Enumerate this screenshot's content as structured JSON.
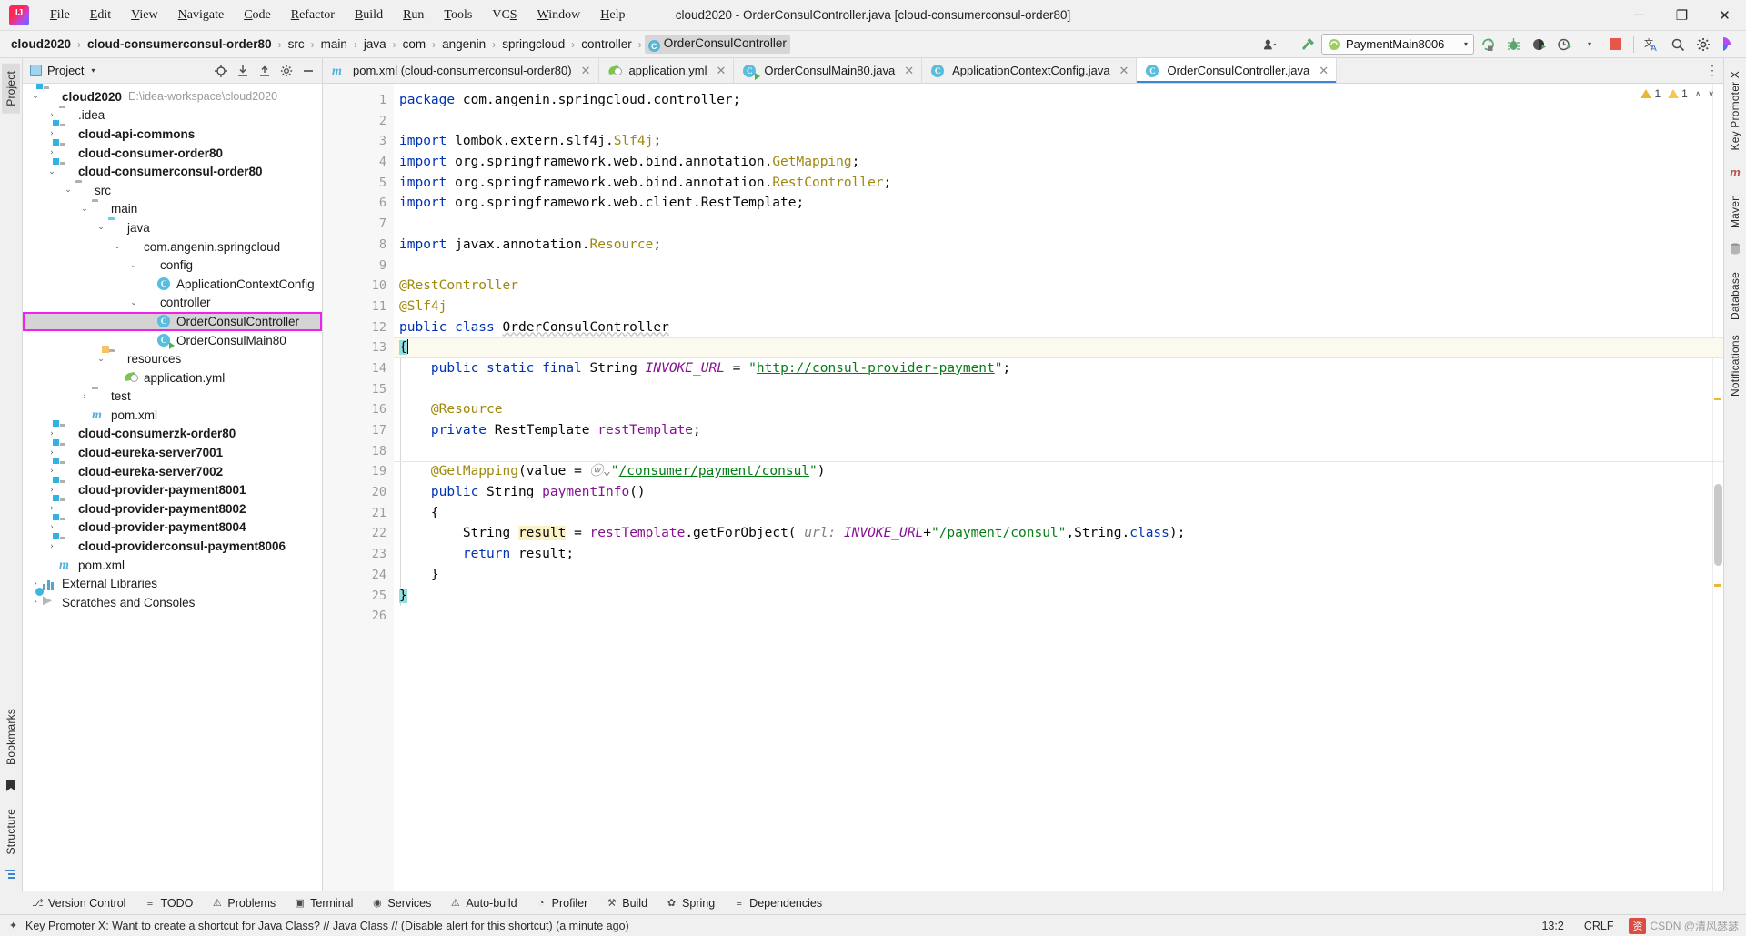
{
  "window": {
    "title": "cloud2020 - OrderConsulController.java [cloud-consumerconsul-order80]",
    "logo_text": "IJ",
    "minimize": "─",
    "maximize": "❐",
    "close": "✕"
  },
  "menubar": {
    "items": [
      {
        "pre": "",
        "mn": "F",
        "post": "ile"
      },
      {
        "pre": "",
        "mn": "E",
        "post": "dit"
      },
      {
        "pre": "",
        "mn": "V",
        "post": "iew"
      },
      {
        "pre": "",
        "mn": "N",
        "post": "avigate"
      },
      {
        "pre": "",
        "mn": "C",
        "post": "ode"
      },
      {
        "pre": "",
        "mn": "R",
        "post": "efactor"
      },
      {
        "pre": "",
        "mn": "B",
        "post": "uild"
      },
      {
        "pre": "",
        "mn": "R",
        "post": "un"
      },
      {
        "pre": "",
        "mn": "T",
        "post": "ools"
      },
      {
        "pre": "VC",
        "mn": "S",
        "post": ""
      },
      {
        "pre": "",
        "mn": "W",
        "post": "indow"
      },
      {
        "pre": "",
        "mn": "H",
        "post": "elp"
      }
    ]
  },
  "breadcrumb": {
    "separator": "›",
    "items": [
      {
        "label": "cloud2020",
        "bold": true,
        "icon": null
      },
      {
        "label": "cloud-consumerconsul-order80",
        "bold": true,
        "icon": null
      },
      {
        "label": "src",
        "bold": false,
        "icon": null
      },
      {
        "label": "main",
        "bold": false,
        "icon": null
      },
      {
        "label": "java",
        "bold": false,
        "icon": null
      },
      {
        "label": "com",
        "bold": false,
        "icon": null
      },
      {
        "label": "angenin",
        "bold": false,
        "icon": null
      },
      {
        "label": "springcloud",
        "bold": false,
        "icon": null
      },
      {
        "label": "controller",
        "bold": false,
        "icon": null
      },
      {
        "label": "OrderConsulController",
        "bold": false,
        "icon": "C"
      }
    ]
  },
  "toolbar": {
    "user_icon": "user-dropdown",
    "build_hammer": "build-icon",
    "run_config_name": "PaymentMain8006",
    "run_config_caret": "▾",
    "rerun": "↻",
    "debug": "debug-icon",
    "coverage": "coverage-icon",
    "profiler": "profiler-icon",
    "profiler_caret": "▾",
    "stop": "stop-icon",
    "translate": "translate-icon",
    "search": "⌕",
    "settings": "⚙",
    "play_brand": "brand-icon"
  },
  "left_strip": {
    "project_tab": "Project",
    "bookmarks_tab": "Bookmarks",
    "structure_tab": "Structure"
  },
  "right_strip": {
    "items": [
      "Key Promoter X",
      "Maven",
      "Database",
      "Notifications"
    ]
  },
  "project_panel": {
    "title": "Project",
    "caret": "▾",
    "icons": [
      "locate-icon",
      "expand-all-icon",
      "collapse-all-icon",
      "settings-icon",
      "hide-icon"
    ],
    "tree": [
      {
        "indent": 0,
        "twist": "⌄",
        "icon": "module",
        "label": "cloud2020",
        "bold": true,
        "path": "E:\\idea-workspace\\cloud2020"
      },
      {
        "indent": 1,
        "twist": "›",
        "icon": "folder",
        "label": ".idea",
        "bold": false,
        "path": ""
      },
      {
        "indent": 1,
        "twist": "›",
        "icon": "module",
        "label": "cloud-api-commons",
        "bold": true,
        "path": ""
      },
      {
        "indent": 1,
        "twist": "›",
        "icon": "module",
        "label": "cloud-consumer-order80",
        "bold": true,
        "path": ""
      },
      {
        "indent": 1,
        "twist": "⌄",
        "icon": "module",
        "label": "cloud-consumerconsul-order80",
        "bold": true,
        "path": ""
      },
      {
        "indent": 2,
        "twist": "⌄",
        "icon": "folder",
        "label": "src",
        "bold": false,
        "path": ""
      },
      {
        "indent": 3,
        "twist": "⌄",
        "icon": "folder",
        "label": "main",
        "bold": false,
        "path": ""
      },
      {
        "indent": 4,
        "twist": "⌄",
        "icon": "folder-blue",
        "label": "java",
        "bold": false,
        "path": ""
      },
      {
        "indent": 5,
        "twist": "⌄",
        "icon": "package",
        "label": "com.angenin.springcloud",
        "bold": false,
        "path": ""
      },
      {
        "indent": 6,
        "twist": "⌄",
        "icon": "package",
        "label": "config",
        "bold": false,
        "path": ""
      },
      {
        "indent": 7,
        "twist": "",
        "icon": "class",
        "label": "ApplicationContextConfig",
        "bold": false,
        "path": ""
      },
      {
        "indent": 6,
        "twist": "⌄",
        "icon": "package",
        "label": "controller",
        "bold": false,
        "path": ""
      },
      {
        "indent": 7,
        "twist": "",
        "icon": "class",
        "label": "OrderConsulController",
        "bold": false,
        "path": "",
        "selected": true,
        "boxed": true
      },
      {
        "indent": 7,
        "twist": "",
        "icon": "class-run",
        "label": "OrderConsulMain80",
        "bold": false,
        "path": ""
      },
      {
        "indent": 4,
        "twist": "⌄",
        "icon": "folder-res",
        "label": "resources",
        "bold": false,
        "path": ""
      },
      {
        "indent": 5,
        "twist": "",
        "icon": "yml",
        "label": "application.yml",
        "bold": false,
        "path": ""
      },
      {
        "indent": 3,
        "twist": "›",
        "icon": "folder",
        "label": "test",
        "bold": false,
        "path": ""
      },
      {
        "indent": 3,
        "twist": "",
        "icon": "maven",
        "label": "pom.xml",
        "bold": false,
        "path": ""
      },
      {
        "indent": 1,
        "twist": "›",
        "icon": "module",
        "label": "cloud-consumerzk-order80",
        "bold": true,
        "path": ""
      },
      {
        "indent": 1,
        "twist": "›",
        "icon": "module",
        "label": "cloud-eureka-server7001",
        "bold": true,
        "path": ""
      },
      {
        "indent": 1,
        "twist": "›",
        "icon": "module",
        "label": "cloud-eureka-server7002",
        "bold": true,
        "path": ""
      },
      {
        "indent": 1,
        "twist": "›",
        "icon": "module",
        "label": "cloud-provider-payment8001",
        "bold": true,
        "path": ""
      },
      {
        "indent": 1,
        "twist": "›",
        "icon": "module",
        "label": "cloud-provider-payment8002",
        "bold": true,
        "path": ""
      },
      {
        "indent": 1,
        "twist": "›",
        "icon": "module",
        "label": "cloud-provider-payment8004",
        "bold": true,
        "path": ""
      },
      {
        "indent": 1,
        "twist": "›",
        "icon": "module",
        "label": "cloud-providerconsul-payment8006",
        "bold": true,
        "path": ""
      },
      {
        "indent": 1,
        "twist": "",
        "icon": "maven",
        "label": "pom.xml",
        "bold": false,
        "path": ""
      },
      {
        "indent": 0,
        "twist": "›",
        "icon": "lib",
        "label": "External Libraries",
        "bold": false,
        "path": ""
      },
      {
        "indent": 0,
        "twist": "›",
        "icon": "scratch",
        "label": "Scratches and Consoles",
        "bold": false,
        "path": ""
      }
    ]
  },
  "editor_tabs": {
    "tabs": [
      {
        "label": "pom.xml (cloud-consumerconsul-order80)",
        "icon": "maven",
        "active": false,
        "close": "✕"
      },
      {
        "label": "application.yml",
        "icon": "yml",
        "active": false,
        "close": "✕"
      },
      {
        "label": "OrderConsulMain80.java",
        "icon": "class-run",
        "active": false,
        "close": "✕"
      },
      {
        "label": "ApplicationContextConfig.java",
        "icon": "class",
        "active": false,
        "close": "✕"
      },
      {
        "label": "OrderConsulController.java",
        "icon": "class",
        "active": true,
        "close": "✕"
      }
    ],
    "overflow": "⋮"
  },
  "inspections": {
    "warn_count_1": "1",
    "warn_count_2": "1",
    "caret_up": "∧",
    "caret_down": "∨"
  },
  "code": {
    "lines": [
      {
        "n": 1,
        "fold": "",
        "run": false,
        "caret": false,
        "tokens": [
          {
            "t": "package ",
            "c": "k"
          },
          {
            "t": "com.angenin.springcloud.controller;",
            "c": ""
          }
        ]
      },
      {
        "n": 2,
        "fold": "",
        "run": false,
        "caret": false,
        "tokens": []
      },
      {
        "n": 3,
        "fold": "⊖",
        "run": false,
        "caret": false,
        "tokens": [
          {
            "t": "import ",
            "c": "k"
          },
          {
            "t": "lombok.extern.slf4j.",
            "c": ""
          },
          {
            "t": "Slf4j",
            "c": "an"
          },
          {
            "t": ";",
            "c": ""
          }
        ]
      },
      {
        "n": 4,
        "fold": "",
        "run": false,
        "caret": false,
        "tokens": [
          {
            "t": "import ",
            "c": "k"
          },
          {
            "t": "org.springframework.web.bind.annotation.",
            "c": ""
          },
          {
            "t": "GetMapping",
            "c": "an"
          },
          {
            "t": ";",
            "c": ""
          }
        ]
      },
      {
        "n": 5,
        "fold": "",
        "run": false,
        "caret": false,
        "tokens": [
          {
            "t": "import ",
            "c": "k"
          },
          {
            "t": "org.springframework.web.bind.annotation.",
            "c": ""
          },
          {
            "t": "RestController",
            "c": "an"
          },
          {
            "t": ";",
            "c": ""
          }
        ]
      },
      {
        "n": 6,
        "fold": "",
        "run": false,
        "caret": false,
        "tokens": [
          {
            "t": "import ",
            "c": "k"
          },
          {
            "t": "org.springframework.web.client.RestTemplate;",
            "c": ""
          }
        ]
      },
      {
        "n": 7,
        "fold": "",
        "run": false,
        "caret": false,
        "tokens": []
      },
      {
        "n": 8,
        "fold": "⊖",
        "run": false,
        "caret": false,
        "tokens": [
          {
            "t": "import ",
            "c": "k"
          },
          {
            "t": "javax.annotation.",
            "c": ""
          },
          {
            "t": "Resource",
            "c": "an"
          },
          {
            "t": ";",
            "c": ""
          }
        ]
      },
      {
        "n": 9,
        "fold": "",
        "run": false,
        "caret": false,
        "tokens": []
      },
      {
        "n": 10,
        "fold": "▽",
        "run": false,
        "caret": false,
        "tokens": [
          {
            "t": "@RestController",
            "c": "an"
          }
        ]
      },
      {
        "n": 11,
        "fold": "⊖",
        "run": false,
        "caret": false,
        "tokens": [
          {
            "t": "@Slf4j",
            "c": "an"
          }
        ]
      },
      {
        "n": 12,
        "fold": "",
        "run": true,
        "caret": false,
        "tokens": [
          {
            "t": "public class ",
            "c": "k"
          },
          {
            "t": "OrderConsulController",
            "c": "sq"
          }
        ]
      },
      {
        "n": 13,
        "fold": "",
        "run": false,
        "caret": true,
        "tokens": [
          {
            "t": "{",
            "c": "brace-hl"
          }
        ]
      },
      {
        "n": 14,
        "fold": "",
        "run": false,
        "caret": false,
        "tokens": [
          {
            "t": "    public static final ",
            "c": "k"
          },
          {
            "t": "String ",
            "c": ""
          },
          {
            "t": "INVOKE_URL",
            "c": "fld"
          },
          {
            "t": " = ",
            "c": ""
          },
          {
            "t": "\"",
            "c": "st"
          },
          {
            "t": "http://consul-provider-payment",
            "c": "url"
          },
          {
            "t": "\"",
            "c": "st"
          },
          {
            "t": ";",
            "c": ""
          }
        ]
      },
      {
        "n": 15,
        "fold": "",
        "run": false,
        "caret": false,
        "tokens": []
      },
      {
        "n": 16,
        "fold": "",
        "run": false,
        "caret": false,
        "tokens": [
          {
            "t": "    @Resource",
            "c": "an"
          }
        ]
      },
      {
        "n": 17,
        "fold": "",
        "run": false,
        "caret": false,
        "tokens": [
          {
            "t": "    private ",
            "c": "k"
          },
          {
            "t": "RestTemplate ",
            "c": ""
          },
          {
            "t": "restTemplate",
            "c": "ifl"
          },
          {
            "t": ";",
            "c": ""
          }
        ]
      },
      {
        "n": 18,
        "fold": "",
        "run": false,
        "caret": false,
        "tokens": []
      },
      {
        "n": 19,
        "fold": "",
        "run": false,
        "caret": false,
        "sep": true,
        "tokens": [
          {
            "t": "    @GetMapping",
            "c": "an"
          },
          {
            "t": "(",
            "c": ""
          },
          {
            "t": "value",
            "c": ""
          },
          {
            "t": " = ",
            "c": ""
          },
          {
            "t": "ⓦ⌄",
            "c": "par"
          },
          {
            "t": "\"",
            "c": "st"
          },
          {
            "t": "/consumer/payment/consul",
            "c": "url"
          },
          {
            "t": "\"",
            "c": "st"
          },
          {
            "t": ")",
            "c": ""
          }
        ]
      },
      {
        "n": 20,
        "fold": "",
        "run": true,
        "caret": false,
        "tokens": [
          {
            "t": "    public ",
            "c": "k"
          },
          {
            "t": "String ",
            "c": ""
          },
          {
            "t": "paymentInfo",
            "c": "ifl"
          },
          {
            "t": "()",
            "c": ""
          }
        ]
      },
      {
        "n": 21,
        "fold": "▽",
        "run": false,
        "caret": false,
        "tokens": [
          {
            "t": "    {",
            "c": ""
          }
        ]
      },
      {
        "n": 22,
        "fold": "",
        "run": false,
        "caret": false,
        "tokens": [
          {
            "t": "        String ",
            "c": ""
          },
          {
            "t": "result",
            "c": "hlw"
          },
          {
            "t": " = ",
            "c": ""
          },
          {
            "t": "restTemplate",
            "c": "ifl"
          },
          {
            "t": ".getForObject( ",
            "c": ""
          },
          {
            "t": "url:",
            "c": "par"
          },
          {
            "t": " ",
            "c": ""
          },
          {
            "t": "INVOKE_URL",
            "c": "fld"
          },
          {
            "t": "+",
            "c": ""
          },
          {
            "t": "\"",
            "c": "st"
          },
          {
            "t": "/payment/consul",
            "c": "url"
          },
          {
            "t": "\"",
            "c": "st"
          },
          {
            "t": ",String.",
            "c": ""
          },
          {
            "t": "class",
            "c": "k"
          },
          {
            "t": ");",
            "c": ""
          }
        ]
      },
      {
        "n": 23,
        "fold": "",
        "run": false,
        "caret": false,
        "tokens": [
          {
            "t": "        return ",
            "c": "k"
          },
          {
            "t": "result;",
            "c": ""
          }
        ]
      },
      {
        "n": 24,
        "fold": "△",
        "run": false,
        "caret": false,
        "tokens": [
          {
            "t": "    }",
            "c": ""
          }
        ]
      },
      {
        "n": 25,
        "fold": "",
        "run": false,
        "caret": false,
        "tokens": [
          {
            "t": "}",
            "c": "brace-hl"
          }
        ]
      },
      {
        "n": 26,
        "fold": "",
        "run": false,
        "caret": false,
        "tokens": []
      }
    ]
  },
  "bottom_bar": {
    "items": [
      {
        "label": "Version Control",
        "icon": "⎇"
      },
      {
        "label": "TODO",
        "icon": "≡"
      },
      {
        "label": "Problems",
        "icon": "⚠"
      },
      {
        "label": "Terminal",
        "icon": "▣"
      },
      {
        "label": "Services",
        "icon": "◉"
      },
      {
        "label": "Auto-build",
        "icon": "⚠"
      },
      {
        "label": "Profiler",
        "icon": "◔"
      },
      {
        "label": "Build",
        "icon": "⚒"
      },
      {
        "label": "Spring",
        "icon": "✿"
      },
      {
        "label": "Dependencies",
        "icon": "≡"
      }
    ]
  },
  "statusbar": {
    "message": "Key Promoter X: Want to create a shortcut for Java Class? // Java Class // (Disable alert for this shortcut) (a minute ago)",
    "position": "13:2",
    "line_sep": "CRLF",
    "watermark_badge": "资",
    "watermark_text": "CSDN @清风瑟瑟"
  }
}
